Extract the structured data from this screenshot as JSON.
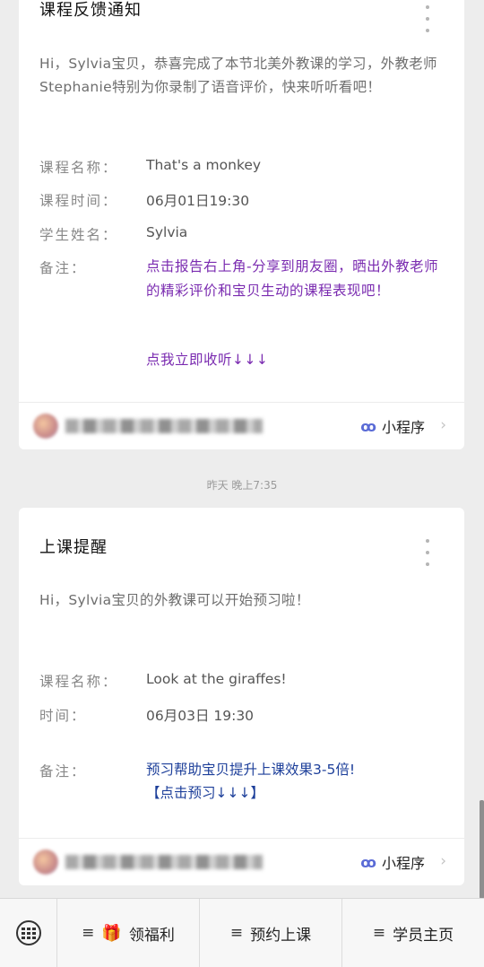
{
  "card1": {
    "title": "课程反馈通知",
    "intro": "Hi，Sylvia宝贝，恭喜完成了本节北美外教课的学习，外教老师Stephanie特别为你录制了语音评价，快来听听看吧！",
    "fields": [
      {
        "label": "课程名称：",
        "value": "That's a monkey"
      },
      {
        "label": "课程时间：",
        "value": "06月01日19:30"
      },
      {
        "label": "学生姓名：",
        "value": "Sylvia"
      }
    ],
    "note_label": "备注：",
    "note_text": "点击报告右上角-分享到朋友圈，晒出外教老师的精彩评价和宝贝生动的课程表现吧！",
    "note_link": "点我立即收听↓↓↓",
    "mini_program": "小程序"
  },
  "timestamp": "昨天 晚上7:35",
  "card2": {
    "title": "上课提醒",
    "intro": "Hi，Sylvia宝贝的外教课可以开始预习啦！",
    "fields": [
      {
        "label": "课程名称：",
        "value": "Look at the giraffes!"
      },
      {
        "label": "时间：",
        "value": "06月03日 19:30"
      }
    ],
    "note_label": "备注：",
    "note_text": "预习帮助宝贝提升上课效果3-5倍!",
    "note_link": "【点击预习↓↓↓】",
    "mini_program": "小程序"
  },
  "bottom_menu": {
    "items": [
      {
        "label": "领福利",
        "icon": "gift-icon"
      },
      {
        "label": "预约上课"
      },
      {
        "label": "学员主页"
      }
    ]
  },
  "colors": {
    "note_purple": "#7a2bb0",
    "note_blue": "#1d3f9a",
    "mini_program_icon": "#5a6bd6"
  }
}
